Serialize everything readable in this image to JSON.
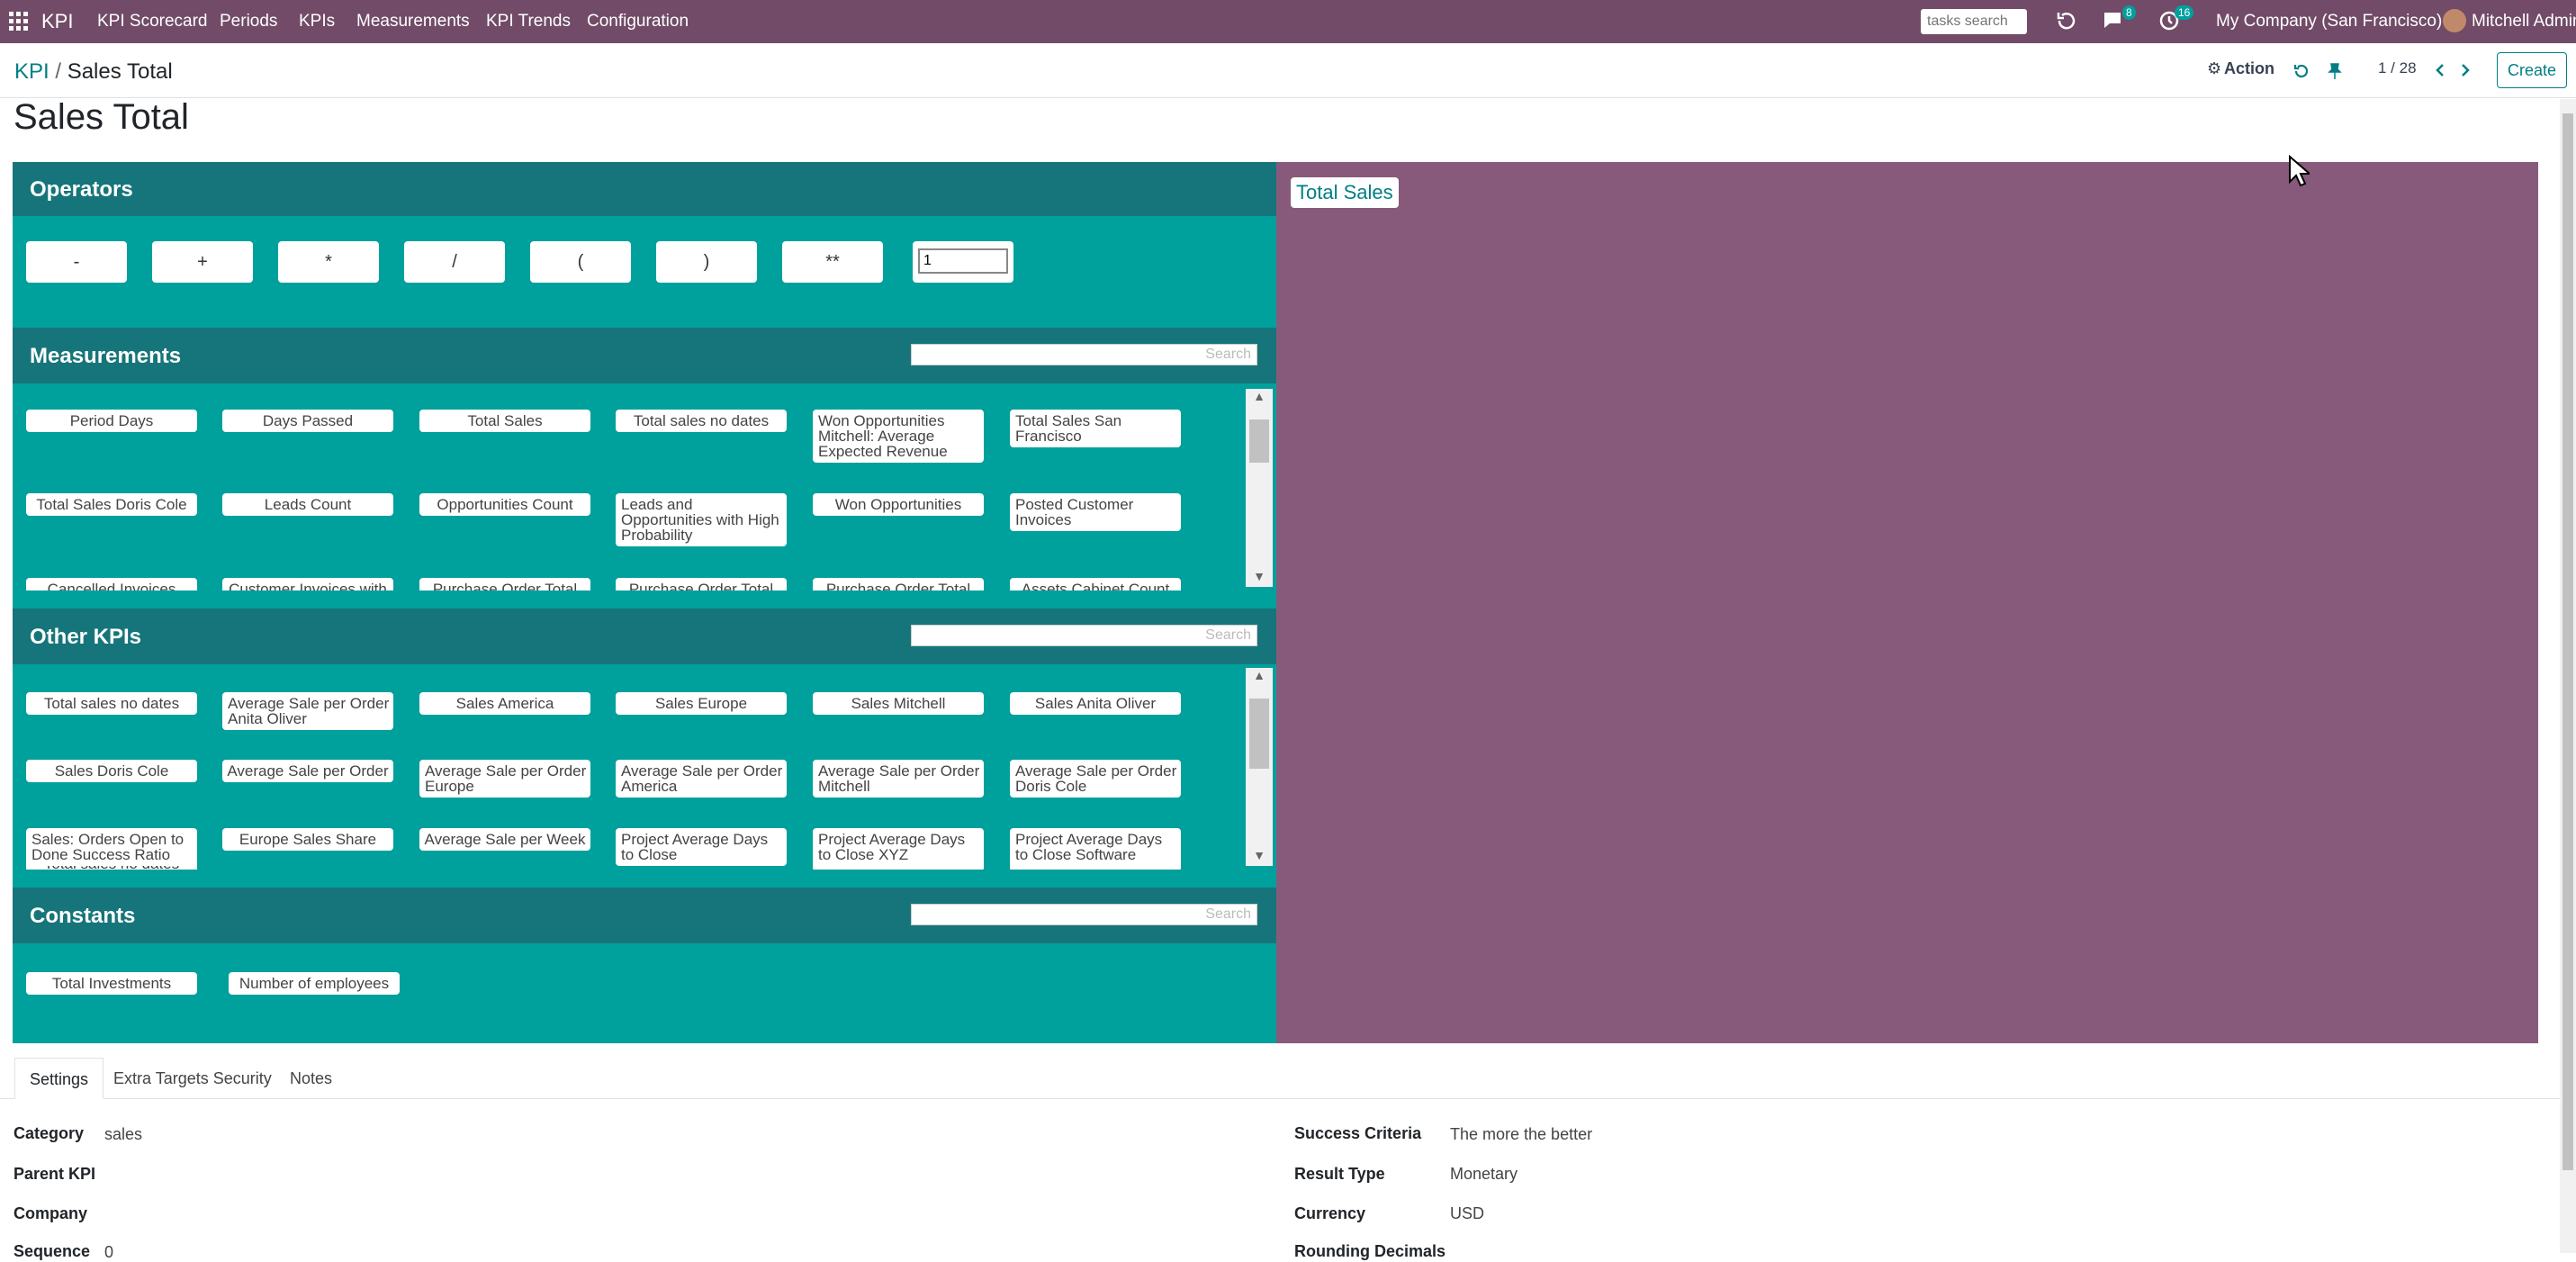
{
  "topnav": {
    "app_name": "KPI",
    "menu": [
      "KPI Scorecard",
      "Periods",
      "KPIs",
      "Measurements",
      "KPI Trends",
      "Configuration"
    ],
    "search_placeholder": "tasks search",
    "messages_count": "8",
    "activities_count": "16",
    "company": "My Company (San Francisco)",
    "user": "Mitchell Admin"
  },
  "breadcrumb": {
    "parent": "KPI",
    "separator": "/",
    "current": "Sales Total"
  },
  "control": {
    "action": "Action",
    "pager": "1 / 28",
    "create": "Create"
  },
  "title": "Sales Total",
  "operators": {
    "title": "Operators",
    "buttons": [
      "-",
      "+",
      "*",
      "/",
      "(",
      ")",
      "**"
    ],
    "number_value": "1"
  },
  "measurements": {
    "title": "Measurements",
    "search_placeholder": "Search",
    "items": [
      "Period Days",
      "Days Passed",
      "Total Sales",
      "Total sales no dates",
      "Won Opportunities Mitchell: Average Expected Revenue",
      "Total Sales San Francisco",
      "Total Sales Doris Cole",
      "Leads Count",
      "Opportunities Count",
      "Leads and Opportunities with High Probability",
      "Won Opportunities",
      "Posted Customer Invoices",
      "Cancelled Invoices",
      "Customer Invoices with",
      "Purchase Order Total",
      "Purchase Order Total",
      "Purchase Order Total",
      "Assets Cabinet Count"
    ]
  },
  "other_kpis": {
    "title": "Other KPIs",
    "search_placeholder": "Search",
    "items": [
      "Total sales no dates",
      "Average Sale per Order Anita Oliver",
      "Sales America",
      "Sales Europe",
      "Sales Mitchell",
      "Sales Anita Oliver",
      "Sales Doris Cole",
      "Average Sale per Order",
      "Average Sale per Order Europe",
      "Average Sale per Order America",
      "Average Sale per Order Mitchell",
      "Average Sale per Order Doris Cole",
      "Sales: Orders Open to Done Success Ratio",
      "Europe Sales Share",
      "Average Sale per Week",
      "Project Average Days to Close",
      "Project Average Days to Close XYZ",
      "Project Average Days to Close Software"
    ]
  },
  "constants": {
    "title": "Constants",
    "search_placeholder": "Search",
    "items": [
      "Total Investments",
      "Number of employees"
    ]
  },
  "formula": {
    "tokens": [
      "Total Sales"
    ]
  },
  "tabs": [
    "Settings",
    "Extra Targets Security",
    "Notes"
  ],
  "fields_left": [
    {
      "label": "Category",
      "value": "sales"
    },
    {
      "label": "Parent KPI",
      "value": ""
    },
    {
      "label": "Company",
      "value": ""
    },
    {
      "label": "Sequence",
      "value": "0"
    }
  ],
  "fields_right": [
    {
      "label": "Success Criteria",
      "value": "The more the better"
    },
    {
      "label": "Result Type",
      "value": "Monetary"
    },
    {
      "label": "Currency",
      "value": "USD"
    },
    {
      "label": "Rounding Decimals",
      "value": ""
    }
  ],
  "colors": {
    "nav": "#714b67",
    "editor": "#00a09d",
    "section_header": "#16757a",
    "formula_panel": "#875a7b",
    "link": "#017e84"
  }
}
